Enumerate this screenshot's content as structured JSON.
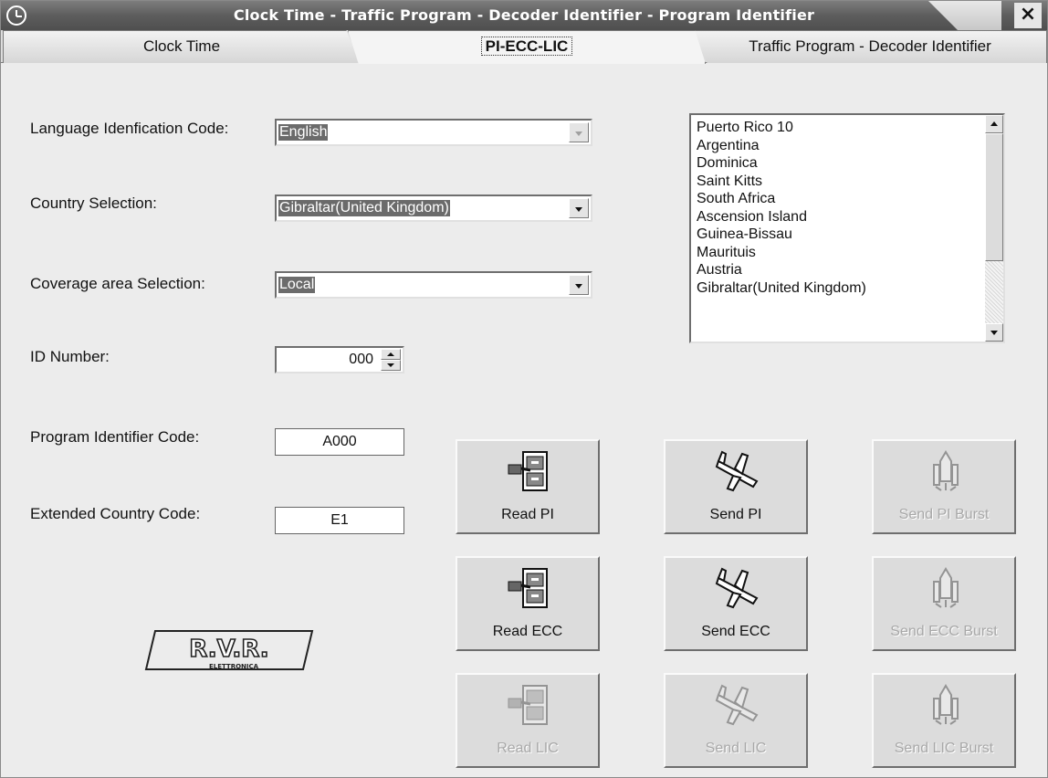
{
  "window": {
    "title": "Clock Time - Traffic Program - Decoder Identifier - Program Identifier",
    "close_icon": "close-icon",
    "app_icon": "clock-icon"
  },
  "tabs": [
    {
      "label": "Clock Time",
      "active": false
    },
    {
      "label": "PI-ECC-LIC",
      "active": true
    },
    {
      "label": "Traffic Program - Decoder Identifier",
      "active": false
    }
  ],
  "form": {
    "language_label": "Language Idenfication Code:",
    "language_value": "English",
    "country_label": "Country Selection:",
    "country_value": "Gibraltar(United Kingdom)",
    "coverage_label": "Coverage area Selection:",
    "coverage_value": "Local",
    "id_label": "ID Number:",
    "id_value": "000",
    "pi_label": "Program Identifier Code:",
    "pi_value": "A000",
    "ecc_label": "Extended Country Code:",
    "ecc_value": "E1"
  },
  "country_list": [
    "Puerto Rico 10",
    "Argentina",
    "Dominica",
    "Saint Kitts",
    "South Africa",
    "Ascension Island",
    "Guinea-Bissau",
    "Maurituis",
    "Austria",
    "Gibraltar(United Kingdom)"
  ],
  "buttons": {
    "read_pi": "Read PI",
    "send_pi": "Send PI",
    "send_pi_burst": "Send PI Burst",
    "read_ecc": "Read ECC",
    "send_ecc": "Send ECC",
    "send_ecc_burst": "Send ECC Burst",
    "read_lic": "Read LIC",
    "send_lic": "Send LIC",
    "send_lic_burst": "Send LIC Burst"
  },
  "logo": {
    "brand": "R.V.R.",
    "sub": "ELETTRONICA"
  }
}
